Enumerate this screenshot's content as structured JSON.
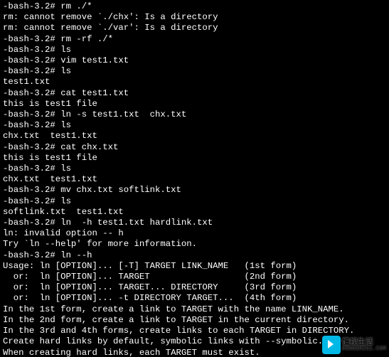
{
  "prompt": "-bash-3.2# ",
  "lines": [
    {
      "type": "prompt",
      "cmd": "rm ./*"
    },
    {
      "type": "out",
      "text": "rm: cannot remove `./chx': Is a directory"
    },
    {
      "type": "out",
      "text": "rm: cannot remove `./var': Is a directory"
    },
    {
      "type": "prompt",
      "cmd": "rm -rf ./*"
    },
    {
      "type": "prompt",
      "cmd": "ls"
    },
    {
      "type": "prompt",
      "cmd": "vim test1.txt"
    },
    {
      "type": "prompt",
      "cmd": "ls"
    },
    {
      "type": "out",
      "text": "test1.txt"
    },
    {
      "type": "prompt",
      "cmd": "cat test1.txt"
    },
    {
      "type": "out",
      "text": "this is test1 file"
    },
    {
      "type": "prompt",
      "cmd": "ln -s test1.txt  chx.txt"
    },
    {
      "type": "prompt",
      "cmd": "ls"
    },
    {
      "type": "out",
      "text": "chx.txt  test1.txt"
    },
    {
      "type": "prompt",
      "cmd": "cat chx.txt"
    },
    {
      "type": "out",
      "text": "this is test1 file"
    },
    {
      "type": "prompt",
      "cmd": "ls"
    },
    {
      "type": "out",
      "text": "chx.txt  test1.txt"
    },
    {
      "type": "prompt",
      "cmd": "mv chx.txt softlink.txt"
    },
    {
      "type": "prompt",
      "cmd": "ls"
    },
    {
      "type": "out",
      "text": "softlink.txt  test1.txt"
    },
    {
      "type": "prompt",
      "cmd": "ln  -h test1.txt hardlink.txt"
    },
    {
      "type": "out",
      "text": "ln: invalid option -- h"
    },
    {
      "type": "out",
      "text": "Try `ln --help' for more information."
    },
    {
      "type": "prompt",
      "cmd": "ln --h"
    },
    {
      "type": "out",
      "text": "Usage: ln [OPTION]... [-T] TARGET LINK_NAME   (1st form)"
    },
    {
      "type": "out",
      "text": "  or:  ln [OPTION]... TARGET                  (2nd form)"
    },
    {
      "type": "out",
      "text": "  or:  ln [OPTION]... TARGET... DIRECTORY     (3rd form)"
    },
    {
      "type": "out",
      "text": "  or:  ln [OPTION]... -t DIRECTORY TARGET...  (4th form)"
    },
    {
      "type": "out",
      "text": "In the 1st form, create a link to TARGET with the name LINK_NAME."
    },
    {
      "type": "out",
      "text": "In the 2nd form, create a link to TARGET in the current directory."
    },
    {
      "type": "out",
      "text": "In the 3rd and 4th forms, create links to each TARGET in DIRECTORY."
    },
    {
      "type": "out",
      "text": "Create hard links by default, symbolic links with --symbolic."
    },
    {
      "type": "out",
      "text": "When creating hard links, each TARGET must exist."
    }
  ],
  "watermark": {
    "cn": "懂视生活",
    "url": "DONGSHI51.COM"
  }
}
